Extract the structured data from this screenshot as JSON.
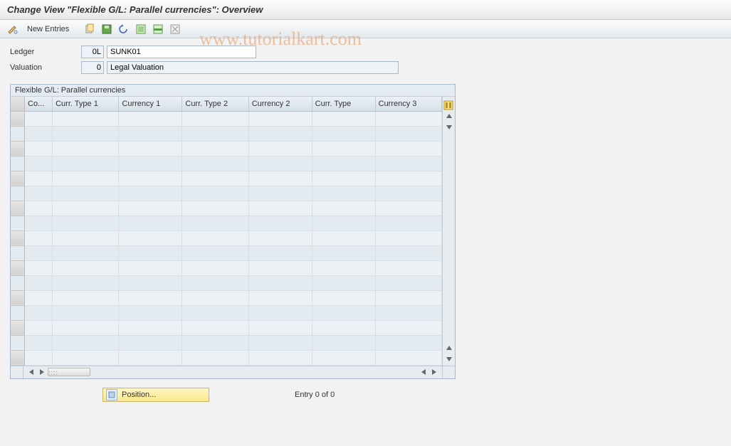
{
  "title": "Change View \"Flexible G/L: Parallel currencies\": Overview",
  "watermark": "www.tutorialkart.com",
  "toolbar": {
    "new_entries_label": "New Entries",
    "icons": {
      "detail": "detail-icon",
      "copy": "copy-icon",
      "delete": "delete-icon",
      "undo": "undo-icon",
      "select_all": "select-all-icon",
      "select_block": "select-block-icon",
      "deselect": "deselect-icon"
    }
  },
  "fields": {
    "ledger_label": "Ledger",
    "ledger_code": "0L",
    "ledger_desc": "SUNK01",
    "valuation_label": "Valuation",
    "valuation_code": "0",
    "valuation_desc": "Legal Valuation"
  },
  "grid": {
    "title": "Flexible G/L: Parallel currencies",
    "columns": [
      "Co...",
      "Curr. Type 1",
      "Currency 1",
      "Curr. Type 2",
      "Currency 2",
      "Curr. Type",
      "Currency 3"
    ],
    "rows": [
      [
        "",
        "",
        "",
        "",
        "",
        "",
        ""
      ],
      [
        "",
        "",
        "",
        "",
        "",
        "",
        ""
      ],
      [
        "",
        "",
        "",
        "",
        "",
        "",
        ""
      ],
      [
        "",
        "",
        "",
        "",
        "",
        "",
        ""
      ],
      [
        "",
        "",
        "",
        "",
        "",
        "",
        ""
      ],
      [
        "",
        "",
        "",
        "",
        "",
        "",
        ""
      ],
      [
        "",
        "",
        "",
        "",
        "",
        "",
        ""
      ],
      [
        "",
        "",
        "",
        "",
        "",
        "",
        ""
      ],
      [
        "",
        "",
        "",
        "",
        "",
        "",
        ""
      ],
      [
        "",
        "",
        "",
        "",
        "",
        "",
        ""
      ],
      [
        "",
        "",
        "",
        "",
        "",
        "",
        ""
      ],
      [
        "",
        "",
        "",
        "",
        "",
        "",
        ""
      ],
      [
        "",
        "",
        "",
        "",
        "",
        "",
        ""
      ],
      [
        "",
        "",
        "",
        "",
        "",
        "",
        ""
      ],
      [
        "",
        "",
        "",
        "",
        "",
        "",
        ""
      ],
      [
        "",
        "",
        "",
        "",
        "",
        "",
        ""
      ],
      [
        "",
        "",
        "",
        "",
        "",
        "",
        ""
      ]
    ]
  },
  "footer": {
    "position_label": "Position...",
    "entry_text": "Entry 0 of 0"
  }
}
